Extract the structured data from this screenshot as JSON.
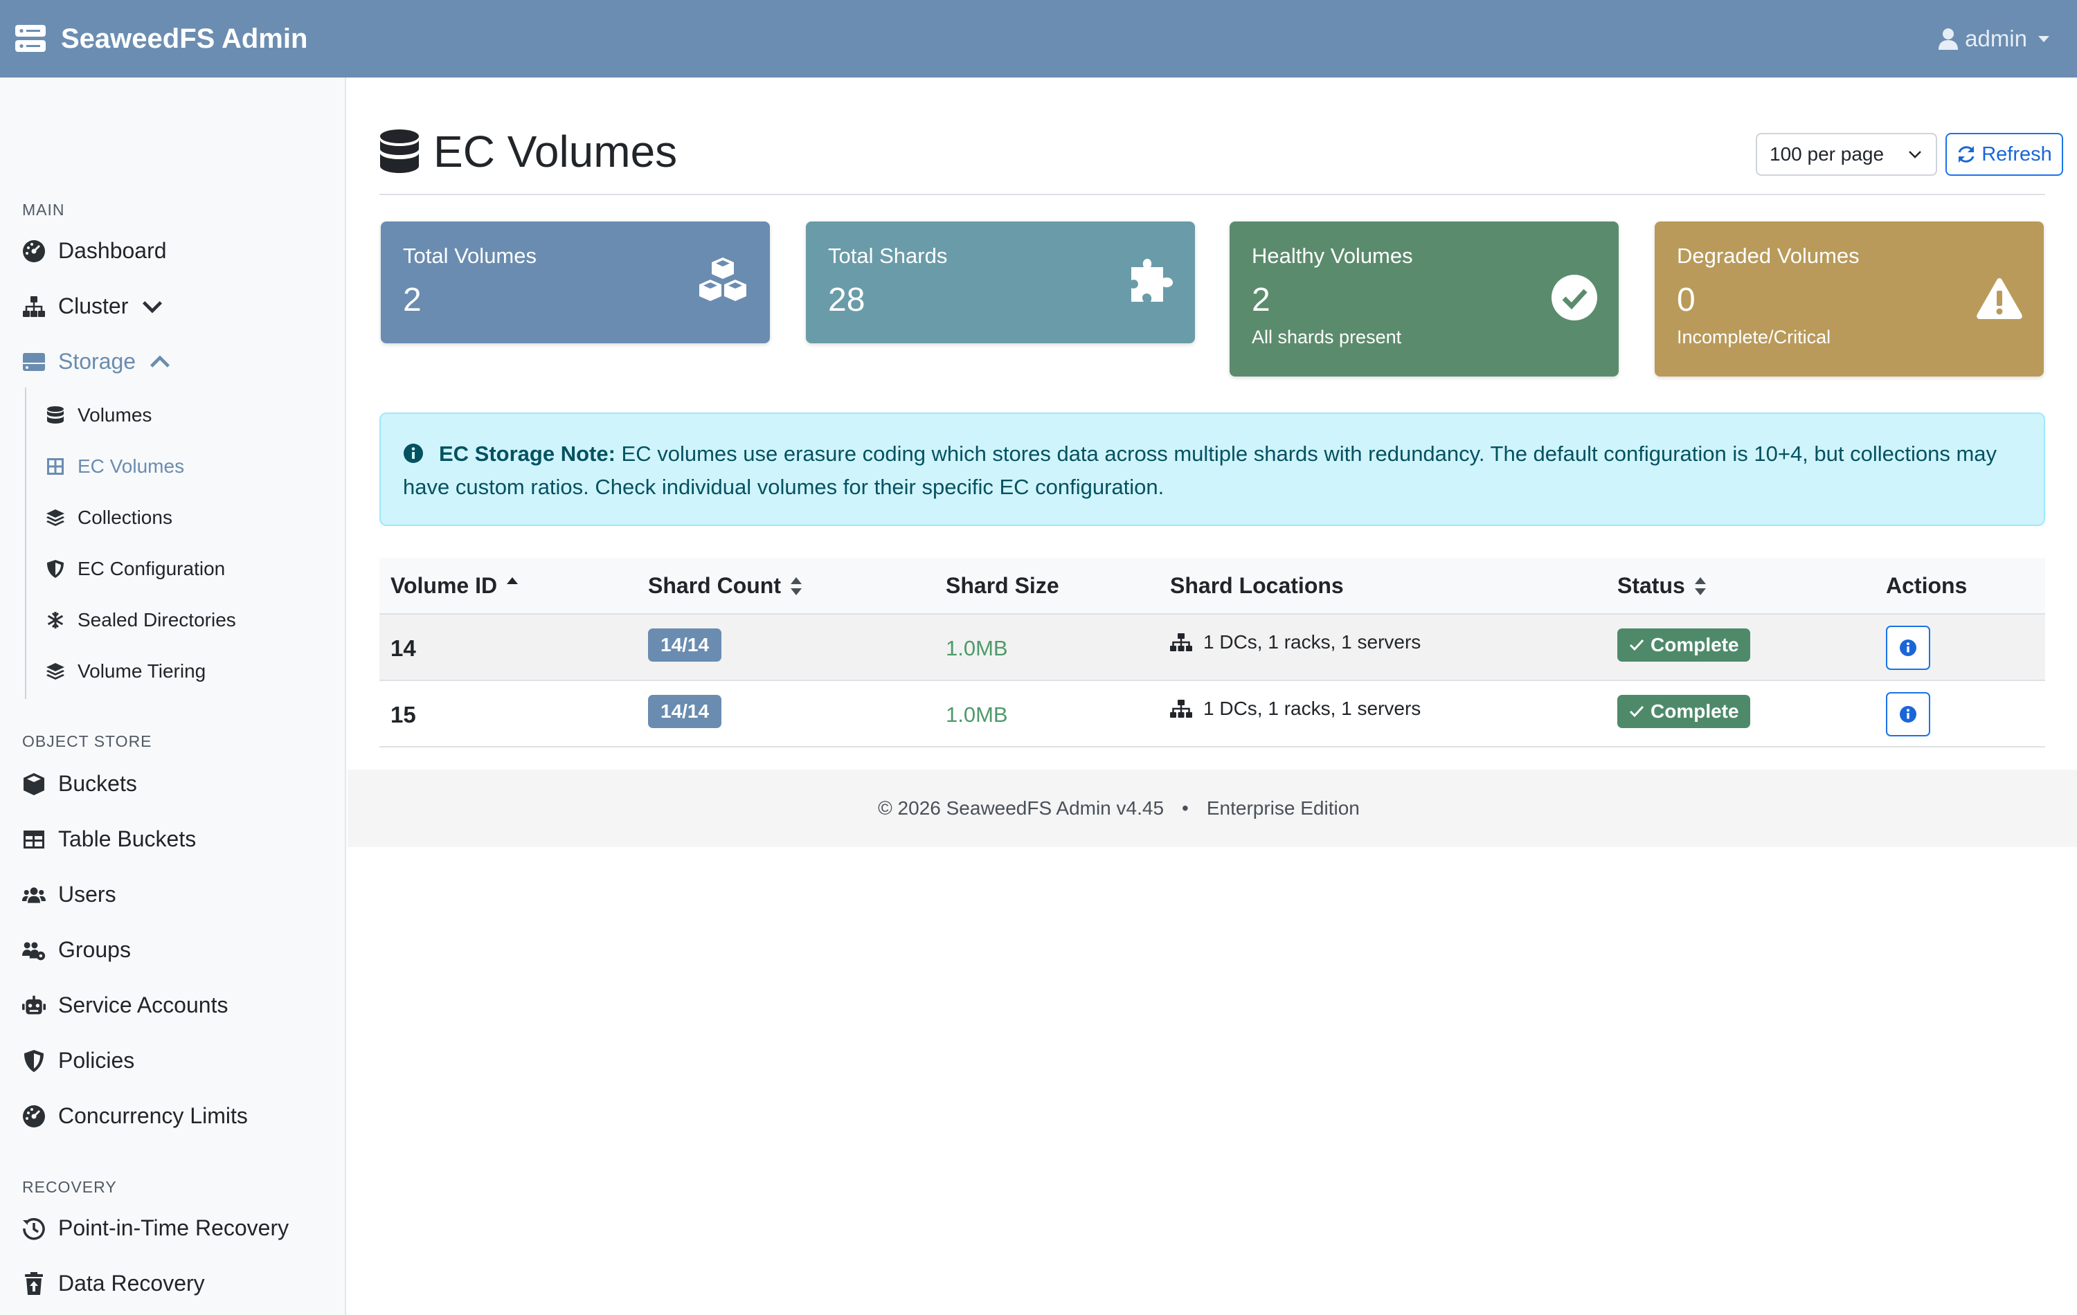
{
  "navbar": {
    "brand": "SeaweedFS Admin",
    "user": "admin"
  },
  "sidebar": {
    "sections": {
      "main": "MAIN",
      "object_store": "OBJECT STORE",
      "recovery": "RECOVERY"
    },
    "main_items": {
      "dashboard": "Dashboard",
      "cluster": "Cluster",
      "storage": "Storage"
    },
    "storage_items": {
      "volumes": "Volumes",
      "ec_volumes": "EC Volumes",
      "collections": "Collections",
      "ec_configuration": "EC Configuration",
      "sealed_directories": "Sealed Directories",
      "volume_tiering": "Volume Tiering"
    },
    "object_store_items": {
      "buckets": "Buckets",
      "table_buckets": "Table Buckets",
      "users": "Users",
      "groups": "Groups",
      "service_accounts": "Service Accounts",
      "policies": "Policies",
      "concurrency_limits": "Concurrency Limits"
    },
    "recovery_items": {
      "pitr": "Point-in-Time Recovery",
      "data_recovery": "Data Recovery"
    }
  },
  "header": {
    "title": "EC Volumes",
    "per_page": "100 per page",
    "refresh": "Refresh"
  },
  "cards": {
    "total_volumes": {
      "label": "Total Volumes",
      "value": "2",
      "color": "#6a8cb0"
    },
    "total_shards": {
      "label": "Total Shards",
      "value": "28",
      "color": "#6a9ba8"
    },
    "healthy": {
      "label": "Healthy Volumes",
      "value": "2",
      "sub": "All shards present",
      "color": "#5b8b6d"
    },
    "degraded": {
      "label": "Degraded Volumes",
      "value": "0",
      "sub": "Incomplete/Critical",
      "color": "#b99a5a"
    }
  },
  "alert": {
    "title": "EC Storage Note:",
    "body": "EC volumes use erasure coding which stores data across multiple shards with redundancy. The default configuration is 10+4, but collections may have custom ratios. Check individual volumes for their specific EC configuration."
  },
  "table": {
    "headers": {
      "volume_id": "Volume ID",
      "shard_count": "Shard Count",
      "shard_size": "Shard Size",
      "shard_locations": "Shard Locations",
      "status": "Status",
      "actions": "Actions"
    },
    "rows": [
      {
        "volume_id": "14",
        "shard_count": "14/14",
        "shard_size": "1.0MB",
        "locations": "1 DCs, 1 racks, 1 servers",
        "status": "Complete"
      },
      {
        "volume_id": "15",
        "shard_count": "14/14",
        "shard_size": "1.0MB",
        "locations": "1 DCs, 1 racks, 1 servers",
        "status": "Complete"
      }
    ]
  },
  "footer": {
    "copyright": "© 2026 SeaweedFS Admin v4.45",
    "separator": "•",
    "edition": "Enterprise Edition"
  }
}
